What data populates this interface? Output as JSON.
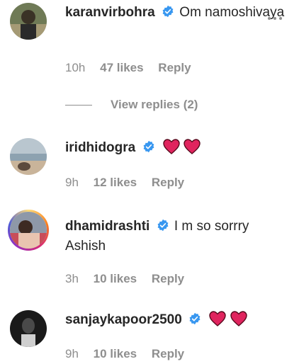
{
  "comments": [
    {
      "username": "karanvirbohra",
      "text": "Om namoshivaya",
      "time": "10h",
      "likes": "47 likes",
      "reply": "Reply",
      "view_replies": "View replies (2)"
    },
    {
      "username": "iridhidogra",
      "text": "",
      "time": "9h",
      "likes": "12 likes",
      "reply": "Reply"
    },
    {
      "username": "dhamidrashti",
      "text": "I m so sorrry Ashish",
      "time": "3h",
      "likes": "10 likes",
      "reply": "Reply"
    },
    {
      "username": "sanjaykapoor2500",
      "text": "",
      "time": "9h",
      "likes": "10 likes",
      "reply": "Reply"
    }
  ],
  "icons": {
    "verified": "verified-badge-icon",
    "heart": "red-heart-emoji",
    "more": "more-options-icon"
  },
  "colors": {
    "verified_blue": "#3897f0",
    "heart_red": "#e0245e",
    "meta_gray": "#8e8e8e",
    "text": "#262626"
  }
}
